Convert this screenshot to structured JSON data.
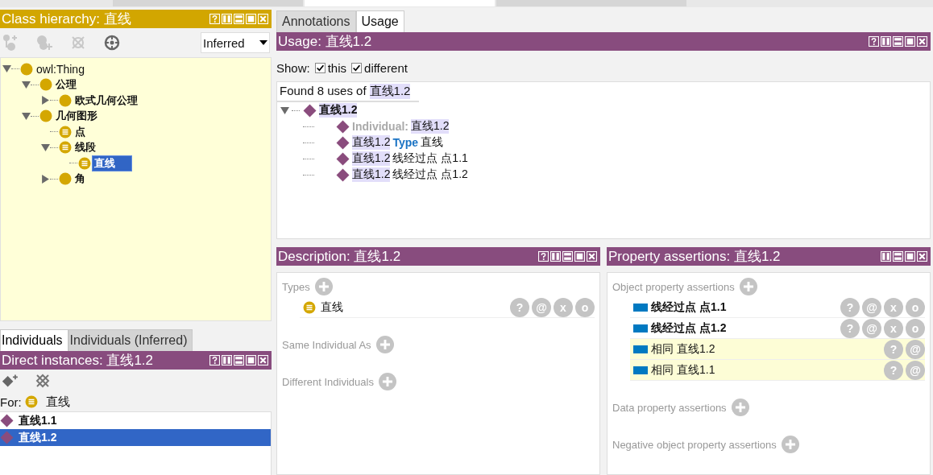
{
  "top_tabs": [
    {
      "selected": false
    },
    {
      "selected": true
    },
    {
      "selected": false
    }
  ],
  "class_hierarchy": {
    "title": "Class hierarchy: 直线",
    "help_button": true,
    "view_mode": "Inferred",
    "tree": [
      {
        "label": "owl:Thing",
        "defined": false,
        "expanded": true,
        "selected": false,
        "children": [
          {
            "label": "公理",
            "defined": false,
            "expanded": true,
            "selected": false,
            "children": [
              {
                "label": "欧式几何公理",
                "defined": false,
                "expanded": false,
                "selected": false
              }
            ]
          },
          {
            "label": "几何图形",
            "defined": false,
            "expanded": true,
            "selected": false,
            "children": [
              {
                "label": "点",
                "defined": true,
                "selected": false
              },
              {
                "label": "线段",
                "defined": true,
                "expanded": true,
                "selected": false,
                "children": [
                  {
                    "label": "直线",
                    "defined": true,
                    "selected": true
                  }
                ]
              },
              {
                "label": "角",
                "defined": false,
                "expanded": false,
                "selected": false
              }
            ]
          }
        ]
      }
    ]
  },
  "individual_tabs": [
    {
      "label": "Individuals",
      "selected": true
    },
    {
      "label": "Individuals (Inferred)",
      "selected": false
    }
  ],
  "direct_instances": {
    "title": "Direct instances: 直线1.2",
    "help_button": true,
    "for_label": "For:",
    "for_class": "直线",
    "items": [
      {
        "label": "直线1.1",
        "selected": false
      },
      {
        "label": "直线1.2",
        "selected": true
      }
    ]
  },
  "right_tabs": [
    {
      "label": "Annotations",
      "selected": false
    },
    {
      "label": "Usage",
      "selected": true
    }
  ],
  "usage": {
    "title": "Usage: 直线1.2",
    "help_button": true,
    "show_label": "Show:",
    "filters": [
      {
        "label": "this",
        "checked": true
      },
      {
        "label": "different",
        "checked": true
      }
    ],
    "found_prefix": "Found 8 uses of",
    "found_entity": "直线1.2",
    "root": {
      "label": "直线1.2",
      "expanded": true,
      "lines": [
        {
          "label": "Individual:",
          "entity": "直线1.2"
        },
        {
          "entity": "直线1.2",
          "keyword": "Type",
          "object": "直线"
        },
        {
          "entity": "直线1.2",
          "object": "线经过点 点1.1"
        },
        {
          "entity": "直线1.2",
          "object": "线经过点 点1.2"
        }
      ]
    }
  },
  "description": {
    "title": "Description: 直线1.2",
    "help_button": true,
    "sections": [
      {
        "label": "Types",
        "items": [
          {
            "label": "直线",
            "actions": [
              "?",
              "@",
              "x",
              "o"
            ]
          }
        ]
      },
      {
        "label": "Same Individual As"
      },
      {
        "label": "Different Individuals"
      }
    ]
  },
  "property_assertions": {
    "title": "Property assertions: 直线1.2",
    "help_button": false,
    "sections": [
      {
        "label": "Object property assertions",
        "items": [
          {
            "property": "线经过点",
            "value": "点1.1",
            "inferred": false,
            "actions": [
              "?",
              "@",
              "x",
              "o"
            ]
          },
          {
            "property": "线经过点",
            "value": "点1.2",
            "inferred": false,
            "actions": [
              "?",
              "@",
              "x",
              "o"
            ]
          },
          {
            "property": "相同",
            "value": "直线1.2",
            "inferred": true,
            "actions": [
              "?",
              "@"
            ]
          },
          {
            "property": "相同",
            "value": "直线1.1",
            "inferred": true,
            "actions": [
              "?",
              "@"
            ]
          }
        ]
      },
      {
        "label": "Data property assertions"
      },
      {
        "label": "Negative object property assertions"
      }
    ]
  }
}
